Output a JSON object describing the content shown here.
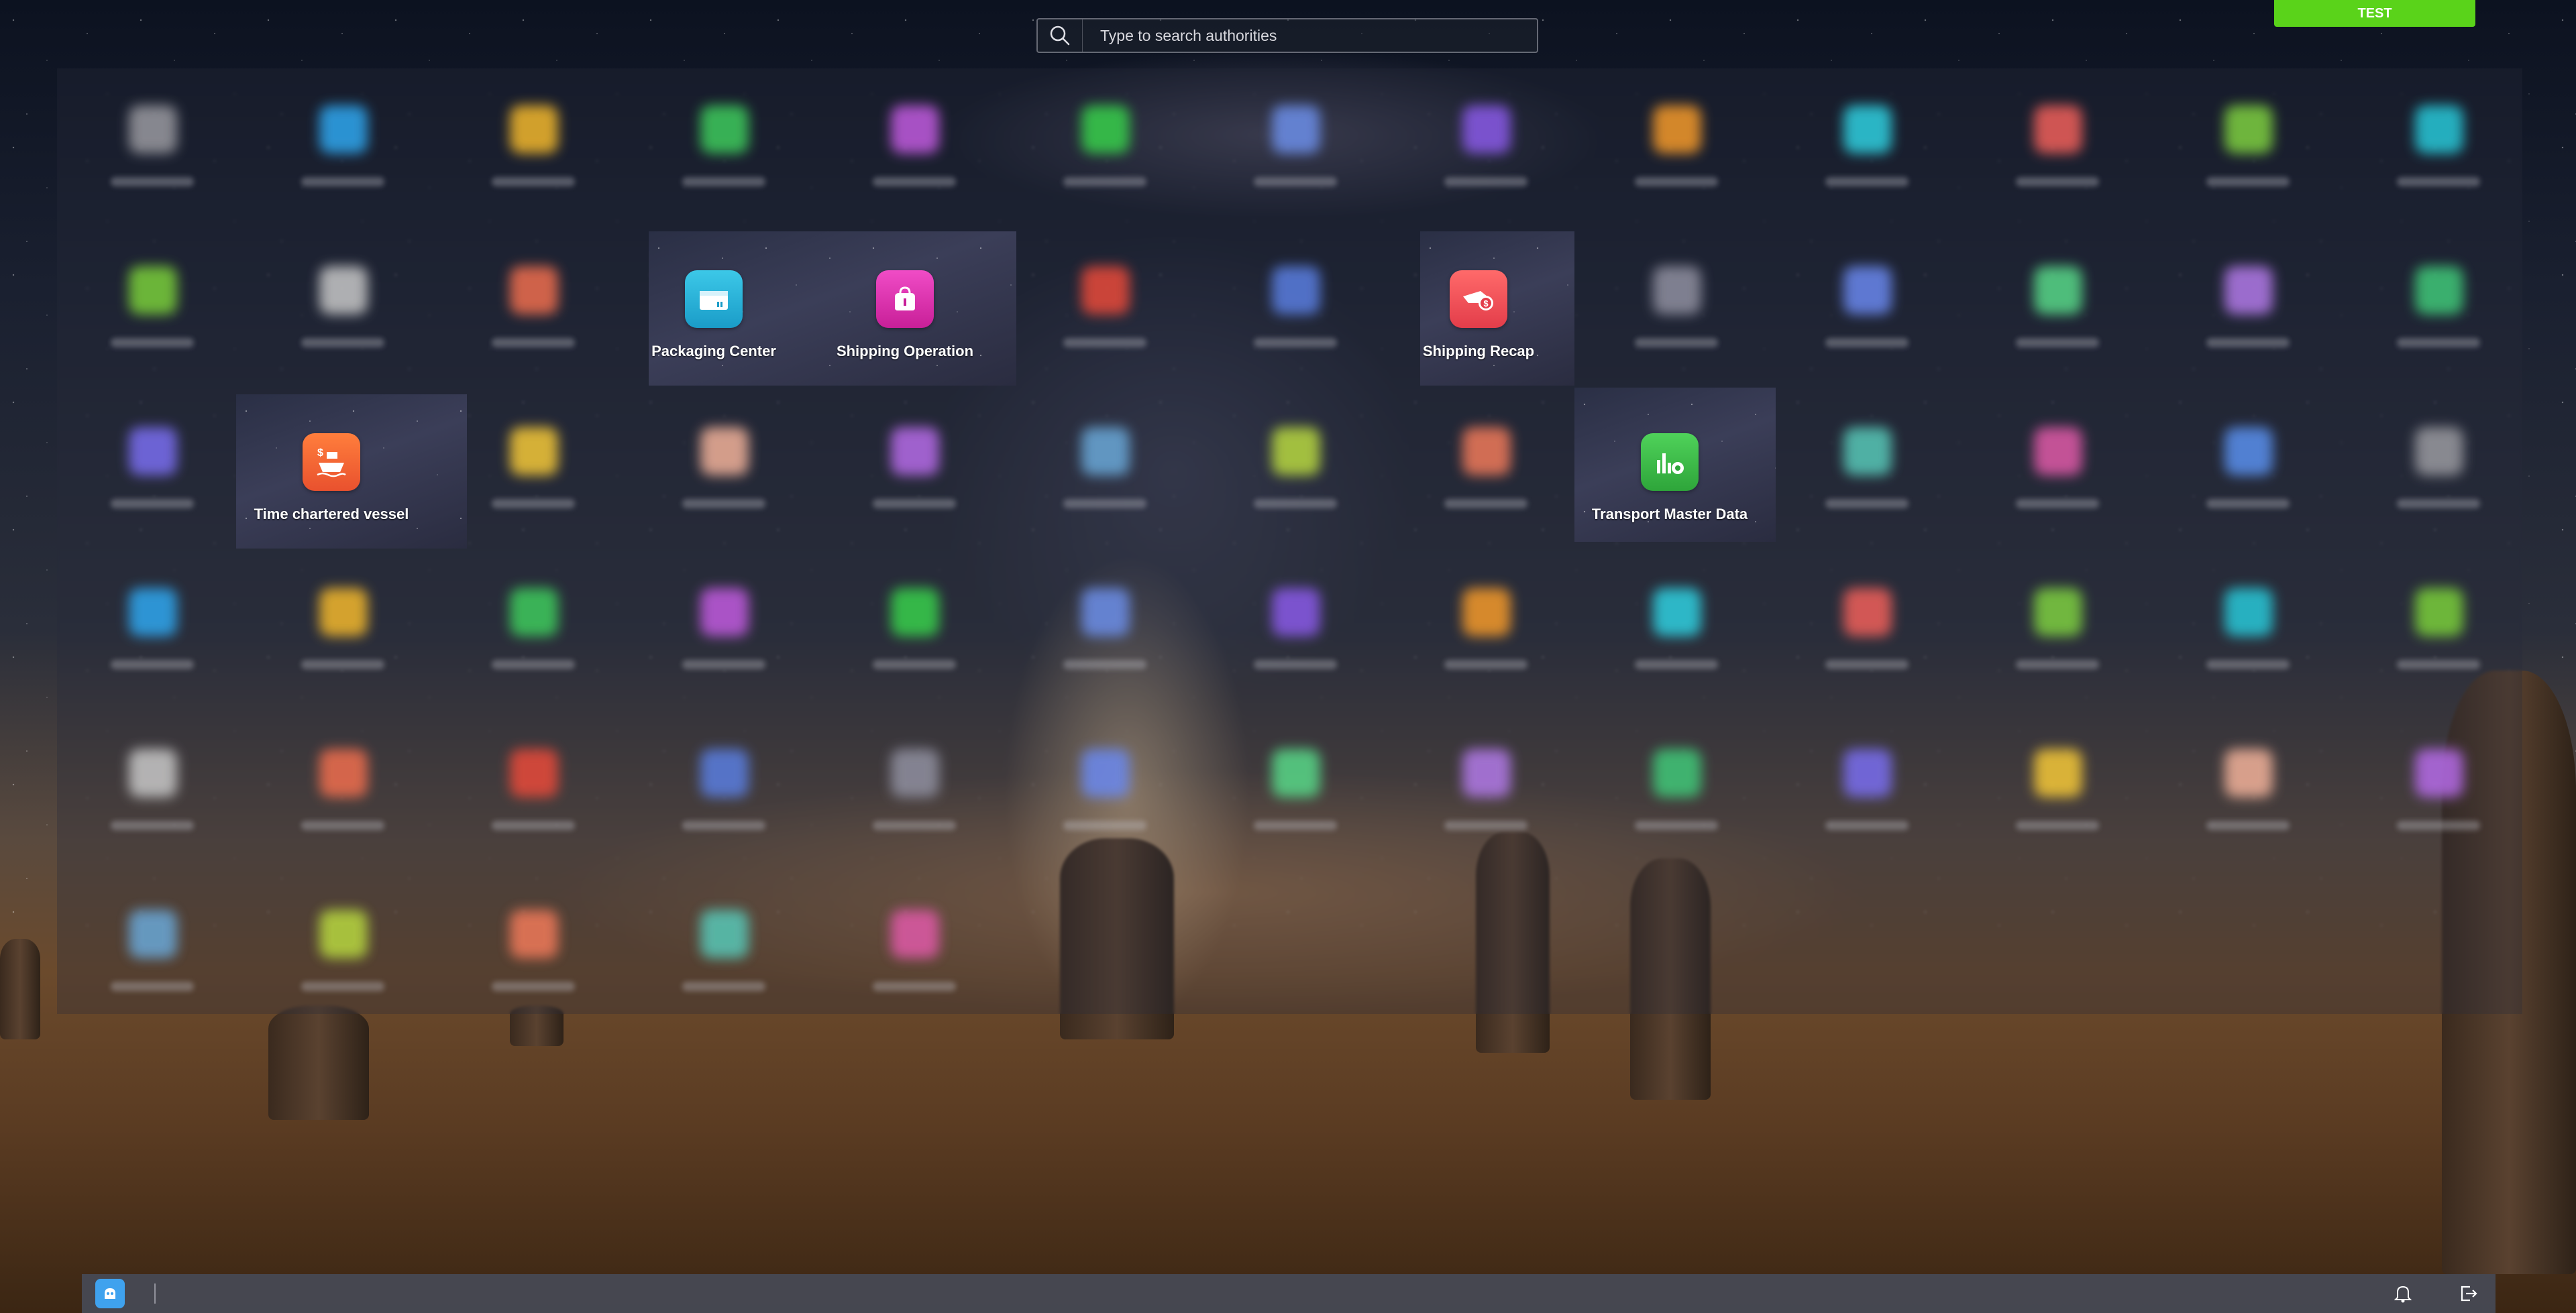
{
  "search": {
    "placeholder": "Type to search authorities"
  },
  "environment_badge": "TEST",
  "apps": [
    {
      "label": "Packaging Center",
      "icon": "packaging-center-icon",
      "color": "#29b6d9"
    },
    {
      "label": "Shipping Operation",
      "icon": "shipping-operation-icon",
      "color": "#e72fb3"
    },
    {
      "label": "Shipping Recap",
      "icon": "shipping-recap-icon",
      "color": "#f2545b"
    },
    {
      "label": "Time chartered vessel",
      "icon": "time-chartered-vessel-icon",
      "color": "#f26b3a"
    },
    {
      "label": "Transport Master Data",
      "icon": "transport-master-data-icon",
      "color": "#3ec04a"
    }
  ],
  "colors": {
    "accent_badge": "#5ad31a",
    "taskbar": "#464a56",
    "start_button": "#3fa2ee"
  },
  "taskbar": {
    "start_icon": "home-app-icon",
    "right_icons": [
      "notification-bell-icon",
      "logout-icon"
    ]
  }
}
